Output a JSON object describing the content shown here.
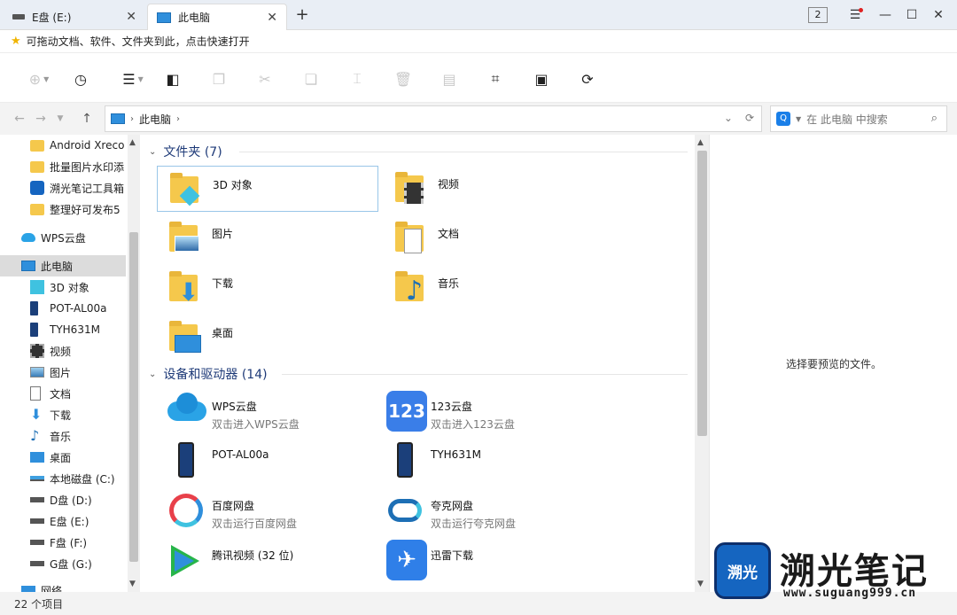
{
  "tabs": [
    {
      "label": "E盘 (E:)",
      "active": false
    },
    {
      "label": "此电脑",
      "active": true
    }
  ],
  "window": {
    "badge": "2"
  },
  "favorites_hint": "可拖动文档、软件、文件夹到此，点击快速打开",
  "address": {
    "path": "此电脑"
  },
  "search": {
    "placeholder": "在 此电脑 中搜索"
  },
  "sidebar": {
    "items": [
      {
        "label": "Android Xreco",
        "icon": "folder-icon"
      },
      {
        "label": "批量图片水印添",
        "icon": "folder-icon"
      },
      {
        "label": "溯光笔记工具箱",
        "icon": "app-icon"
      },
      {
        "label": "整理好可发布5",
        "icon": "folder-icon"
      },
      {
        "label": "WPS云盘",
        "icon": "cloud-icon"
      },
      {
        "label": "此电脑",
        "icon": "computer-icon"
      },
      {
        "label": "3D 对象",
        "icon": "cube-icon"
      },
      {
        "label": "POT-AL00a",
        "icon": "phone-icon"
      },
      {
        "label": "TYH631M",
        "icon": "phone-icon"
      },
      {
        "label": "视频",
        "icon": "video-icon"
      },
      {
        "label": "图片",
        "icon": "picture-icon"
      },
      {
        "label": "文档",
        "icon": "document-icon"
      },
      {
        "label": "下载",
        "icon": "download-icon"
      },
      {
        "label": "音乐",
        "icon": "music-icon"
      },
      {
        "label": "桌面",
        "icon": "desktop-icon"
      },
      {
        "label": "本地磁盘 (C:)",
        "icon": "system-drive-icon"
      },
      {
        "label": "D盘 (D:)",
        "icon": "drive-icon"
      },
      {
        "label": "E盘 (E:)",
        "icon": "drive-icon"
      },
      {
        "label": "F盘 (F:)",
        "icon": "drive-icon"
      },
      {
        "label": "G盘 (G:)",
        "icon": "drive-icon"
      },
      {
        "label": "网络",
        "icon": "network-icon"
      }
    ]
  },
  "groups": {
    "folders": {
      "title": "文件夹 (7)"
    },
    "devices": {
      "title": "设备和驱动器 (14)"
    }
  },
  "folders": [
    {
      "name": "3D 对象",
      "icon": "cube-icon"
    },
    {
      "name": "视频",
      "icon": "video-icon"
    },
    {
      "name": "图片",
      "icon": "picture-icon"
    },
    {
      "name": "文档",
      "icon": "document-icon"
    },
    {
      "name": "下载",
      "icon": "download-icon"
    },
    {
      "name": "音乐",
      "icon": "music-icon"
    },
    {
      "name": "桌面",
      "icon": "desktop-icon"
    }
  ],
  "devices": [
    {
      "name": "WPS云盘",
      "sub": "双击进入WPS云盘",
      "icon": "wps-cloud-icon"
    },
    {
      "name": "123云盘",
      "sub": "双击进入123云盘",
      "icon": "123-cloud-icon"
    },
    {
      "name": "POT-AL00a",
      "sub": "",
      "icon": "phone-icon"
    },
    {
      "name": "TYH631M",
      "sub": "",
      "icon": "phone-icon"
    },
    {
      "name": "百度网盘",
      "sub": "双击运行百度网盘",
      "icon": "baidu-netdisk-icon"
    },
    {
      "name": "夸克网盘",
      "sub": "双击运行夸克网盘",
      "icon": "quark-netdisk-icon"
    },
    {
      "name": "腾讯视频 (32 位)",
      "sub": "",
      "icon": "tencent-video-icon"
    },
    {
      "name": "迅雷下载",
      "sub": "",
      "icon": "xunlei-icon"
    }
  ],
  "preview": {
    "message": "选择要预览的文件。"
  },
  "status": {
    "count": "22 个项目"
  },
  "watermark": {
    "logo": "溯光",
    "title": "溯光笔记",
    "url": "www.suguang999.cn"
  },
  "colors": {
    "accent": "#1a7fe8",
    "group_title": "#1e3a78",
    "selection": "#99c6e8",
    "folder": "#f5c84c"
  }
}
